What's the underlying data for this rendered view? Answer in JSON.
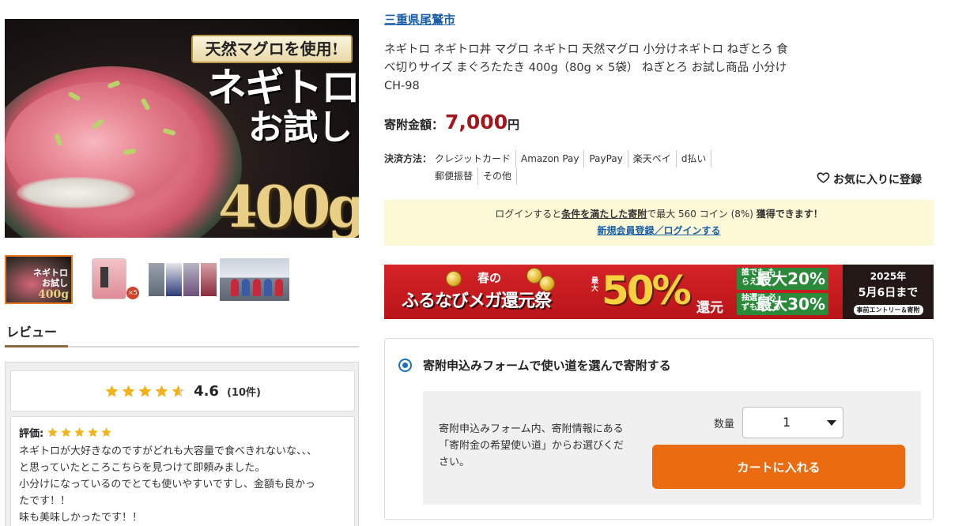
{
  "main_image": {
    "tag": "天然マグロを使用!",
    "headline": "ネギトロ",
    "subheadline": "お試し",
    "weight": "400g"
  },
  "thumbnails": [
    {
      "name": "thumb-main",
      "mini_title": "ネギトロ",
      "mini_sub": "お試し",
      "mini_weight": "400g"
    },
    {
      "name": "thumb-package",
      "badge": "×5"
    },
    {
      "name": "thumb-scenes"
    },
    {
      "name": "thumb-team"
    }
  ],
  "review_section": {
    "tab_label": "レビュー",
    "rating": "4.6",
    "count": "(10件)",
    "stars_filled": 4.6,
    "review": {
      "label": "評価:",
      "stars": 5,
      "lines": [
        "ネギトロが大好きなのですがどれも大容量で食べきれないな、、、",
        "と思っていたところこちらを見つけて即頼みました。",
        "小分けになっているのでとても使いやすいですし、金額も良かっ",
        "たです！！",
        "味も美味しかったです！！"
      ]
    }
  },
  "product": {
    "municipality": "三重県尾鷲市",
    "title": "ネギトロ ネギトロ丼 マグロ ネギトロ 天然マグロ 小分けネギトロ ねぎとろ 食べ切りサイズ まぐろたたき 400g（80g × 5袋） ねぎとろ お試し商品 小分け CH-98",
    "price_label": "寄附金額：",
    "price_value": "7,000",
    "price_unit": "円"
  },
  "payment": {
    "label": "決済方法：",
    "methods_row1": [
      "クレジットカード",
      "Amazon Pay",
      "PayPay",
      "楽天ペイ",
      "d払い"
    ],
    "methods_row2": [
      "郵便振替",
      "その他"
    ]
  },
  "favorite": {
    "label": "お気に入りに登録"
  },
  "login_banner": {
    "text_before": "ログインすると",
    "text_link": "条件を満たした寄附",
    "text_middle": "で最大 560 コイン (8%) ",
    "text_bold": "獲得できます！",
    "register_link": "新規会員登録／ログインする"
  },
  "campaign": {
    "spring": "春の",
    "main": "ふるなびメガ還元祭",
    "max": "最大",
    "percent": "50%",
    "return": "還元",
    "box1_text": "誰でも もらえる",
    "box1_pct": "最大20%",
    "box2_text": "抽選で 必ずもらえる",
    "box2_pct": "最大30%",
    "year": "2025年",
    "date": "5月6日まで",
    "entry": "事前エントリー＆寄附",
    "accent": "#d42428"
  },
  "donation_form": {
    "option_label": "寄附申込みフォームで使い道を選んで寄附する",
    "description": "寄附申込みフォーム内、寄附情報にある「寄附金の希望使い道」からお選びください。",
    "qty_label": "数量",
    "qty_value": "1",
    "cart_button": "カートに入れる",
    "button_color": "#ea6b10"
  }
}
